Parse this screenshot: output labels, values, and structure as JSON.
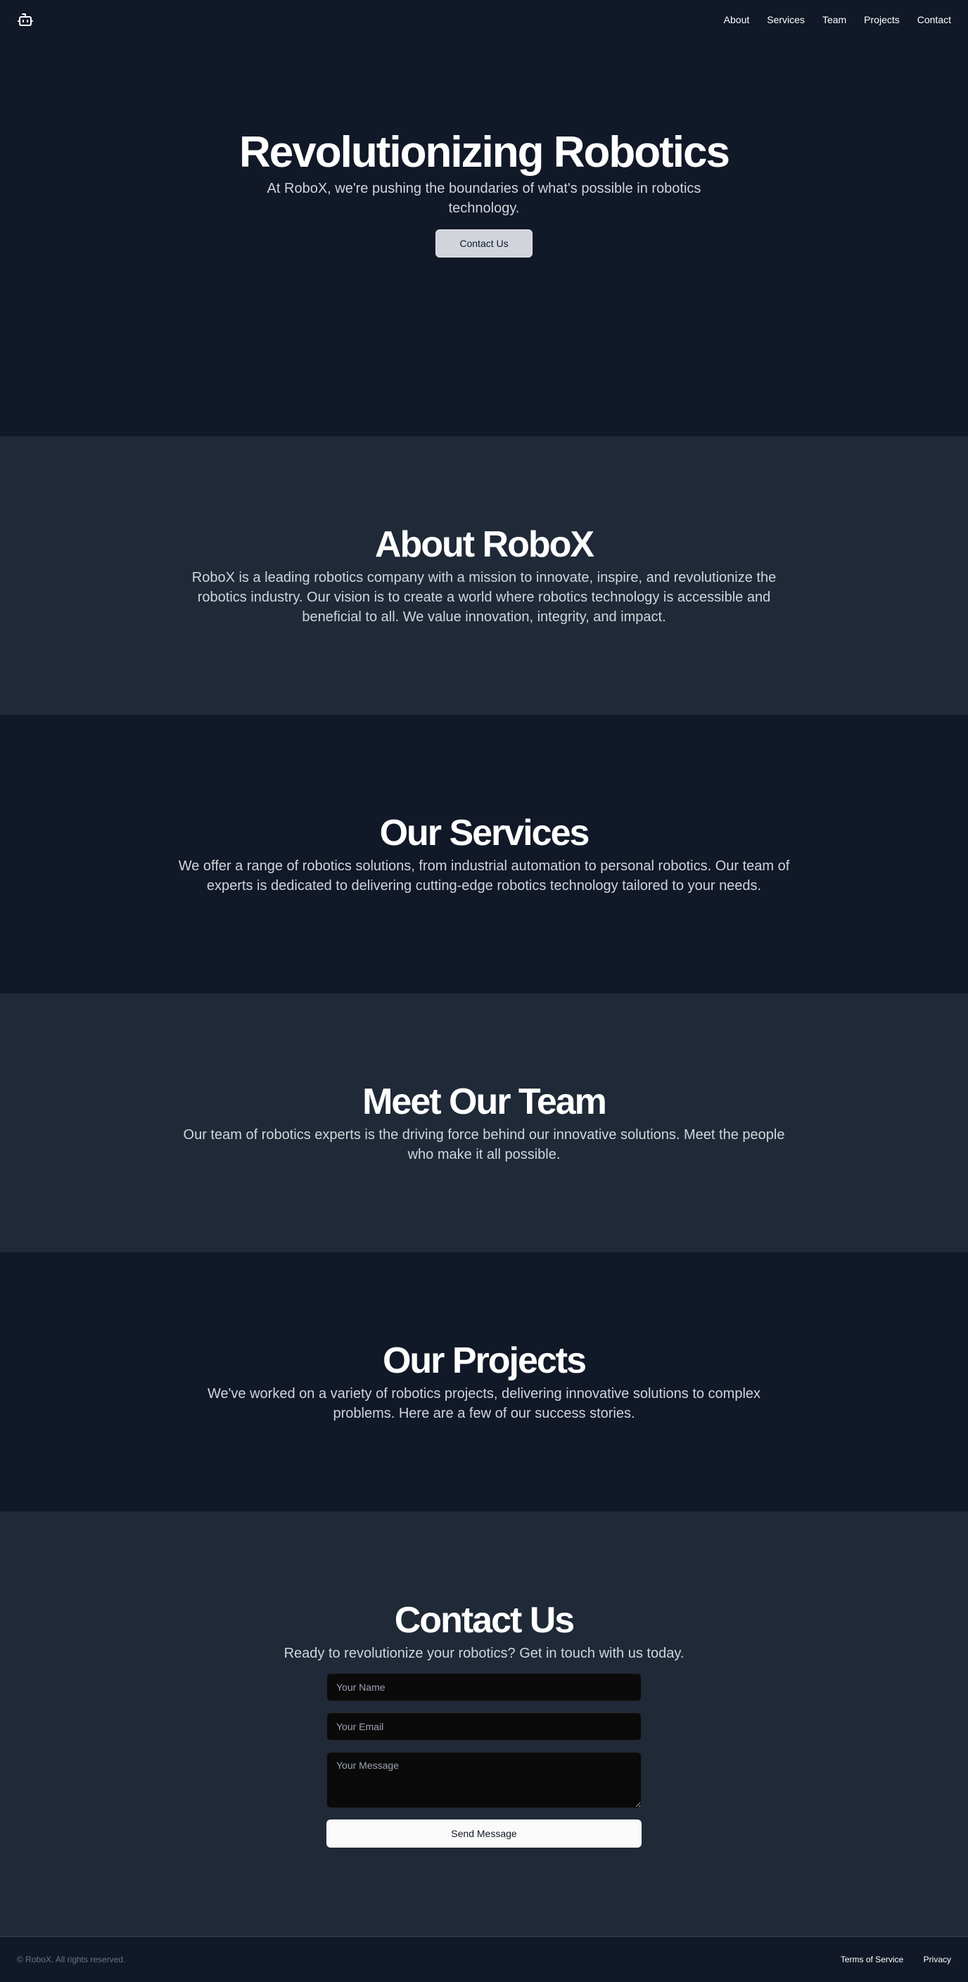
{
  "header": {
    "logo_icon": "robot-icon",
    "nav": [
      "About",
      "Services",
      "Team",
      "Projects",
      "Contact"
    ]
  },
  "hero": {
    "title": "Revolutionizing Robotics",
    "subtitle": "At RoboX, we're pushing the boundaries of what's possible in robotics technology.",
    "button": "Contact Us"
  },
  "about": {
    "title": "About RoboX",
    "text": "RoboX is a leading robotics company with a mission to innovate, inspire, and revolutionize the robotics industry. Our vision is to create a world where robotics technology is accessible and beneficial to all. We value innovation, integrity, and impact."
  },
  "services": {
    "title": "Our Services",
    "text": "We offer a range of robotics solutions, from industrial automation to personal robotics. Our team of experts is dedicated to delivering cutting-edge robotics technology tailored to your needs."
  },
  "team": {
    "title": "Meet Our Team",
    "text": "Our team of robotics experts is the driving force behind our innovative solutions. Meet the people who make it all possible."
  },
  "projects": {
    "title": "Our Projects",
    "text": "We've worked on a variety of robotics projects, delivering innovative solutions to complex problems. Here are a few of our success stories."
  },
  "contact": {
    "title": "Contact Us",
    "text": "Ready to revolutionize your robotics? Get in touch with us today.",
    "name_placeholder": "Your Name",
    "email_placeholder": "Your Email",
    "message_placeholder": "Your Message",
    "submit": "Send Message"
  },
  "footer": {
    "copyright": "© RoboX. All rights reserved.",
    "links": [
      "Terms of Service",
      "Privacy"
    ]
  },
  "colors": {
    "dark_bg": "#111827",
    "mid_bg": "#1f2937",
    "muted_text": "#d1d5db",
    "button_light": "#d1d5db"
  }
}
